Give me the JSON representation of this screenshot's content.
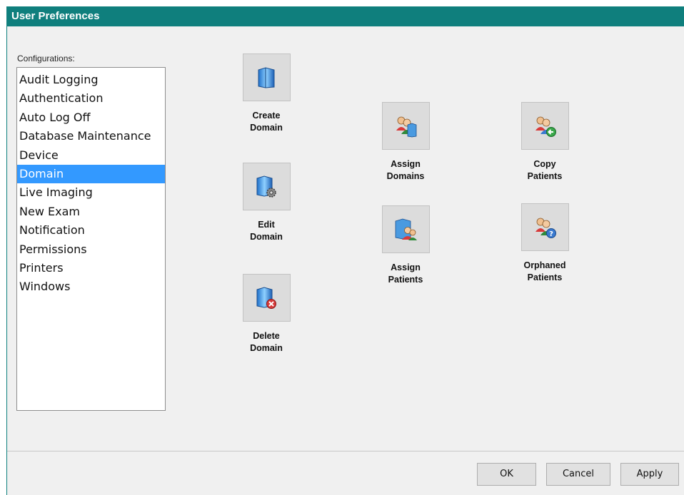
{
  "window": {
    "title": "User Preferences",
    "accent": "#0f7f7d"
  },
  "configurations": {
    "label": "Configurations:",
    "items": [
      {
        "label": "Audit Logging"
      },
      {
        "label": "Authentication"
      },
      {
        "label": "Auto Log Off"
      },
      {
        "label": "Database Maintenance"
      },
      {
        "label": "Device"
      },
      {
        "label": "Domain",
        "selected": true
      },
      {
        "label": "Live Imaging"
      },
      {
        "label": "New Exam"
      },
      {
        "label": "Notification"
      },
      {
        "label": "Permissions"
      },
      {
        "label": "Printers"
      },
      {
        "label": "Windows"
      }
    ],
    "selected_color": "#3399ff"
  },
  "actions": {
    "create_domain": {
      "label": "Create\nDomain",
      "icon": "create-domain-icon"
    },
    "edit_domain": {
      "label": "Edit\nDomain",
      "icon": "edit-domain-icon"
    },
    "delete_domain": {
      "label": "Delete\nDomain",
      "icon": "delete-domain-icon"
    },
    "assign_domains": {
      "label": "Assign\nDomains",
      "icon": "assign-domains-icon"
    },
    "assign_patients": {
      "label": "Assign\nPatients",
      "icon": "assign-patients-icon"
    },
    "copy_patients": {
      "label": "Copy\nPatients",
      "icon": "copy-patients-icon"
    },
    "orphaned_patients": {
      "label": "Orphaned\nPatients",
      "icon": "orphaned-patients-icon"
    }
  },
  "footer": {
    "ok": "OK",
    "cancel": "Cancel",
    "apply": "Apply"
  }
}
